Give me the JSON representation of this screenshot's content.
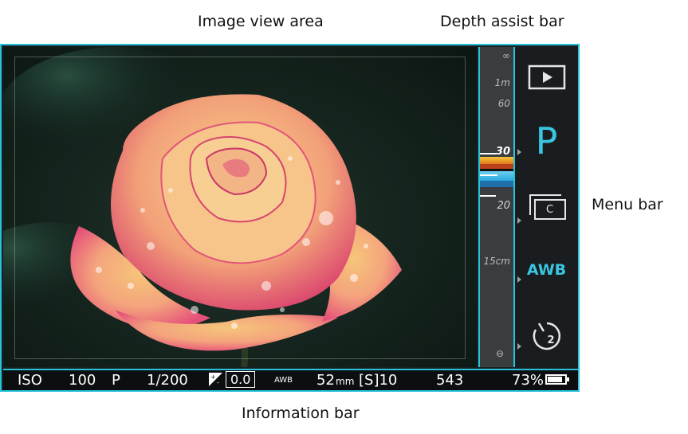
{
  "captions": {
    "image_view_area": "Image view area",
    "depth_assist_bar": "Depth assist bar",
    "menu_bar": "Menu bar",
    "information_bar": "Information bar"
  },
  "depth_scale": {
    "infinity": "∞",
    "one_meter": "1m",
    "sixty": "60",
    "thirty": "30",
    "twenty": "20",
    "fifteen_cm": "15cm",
    "min_symbol": "⊖"
  },
  "menu": {
    "mode": "P",
    "white_balance": "AWB",
    "custom_label": "C",
    "timer_count": "2",
    "icons": [
      "playback-icon",
      "custom-mode-icon",
      "self-timer-icon"
    ]
  },
  "info": {
    "iso_label": "ISO",
    "iso_value": "100",
    "mode": "P",
    "shutter": "1/200",
    "exposure_comp": "0.0",
    "white_balance": "AWB",
    "focal_length": "52",
    "focal_unit": "mm",
    "shots_label": "[S]10",
    "remaining": "543",
    "battery": "73%"
  },
  "colors": {
    "accent": "#26c3d9",
    "focus_orange": "#e07a1a",
    "focus_blue": "#2aa6e0"
  }
}
